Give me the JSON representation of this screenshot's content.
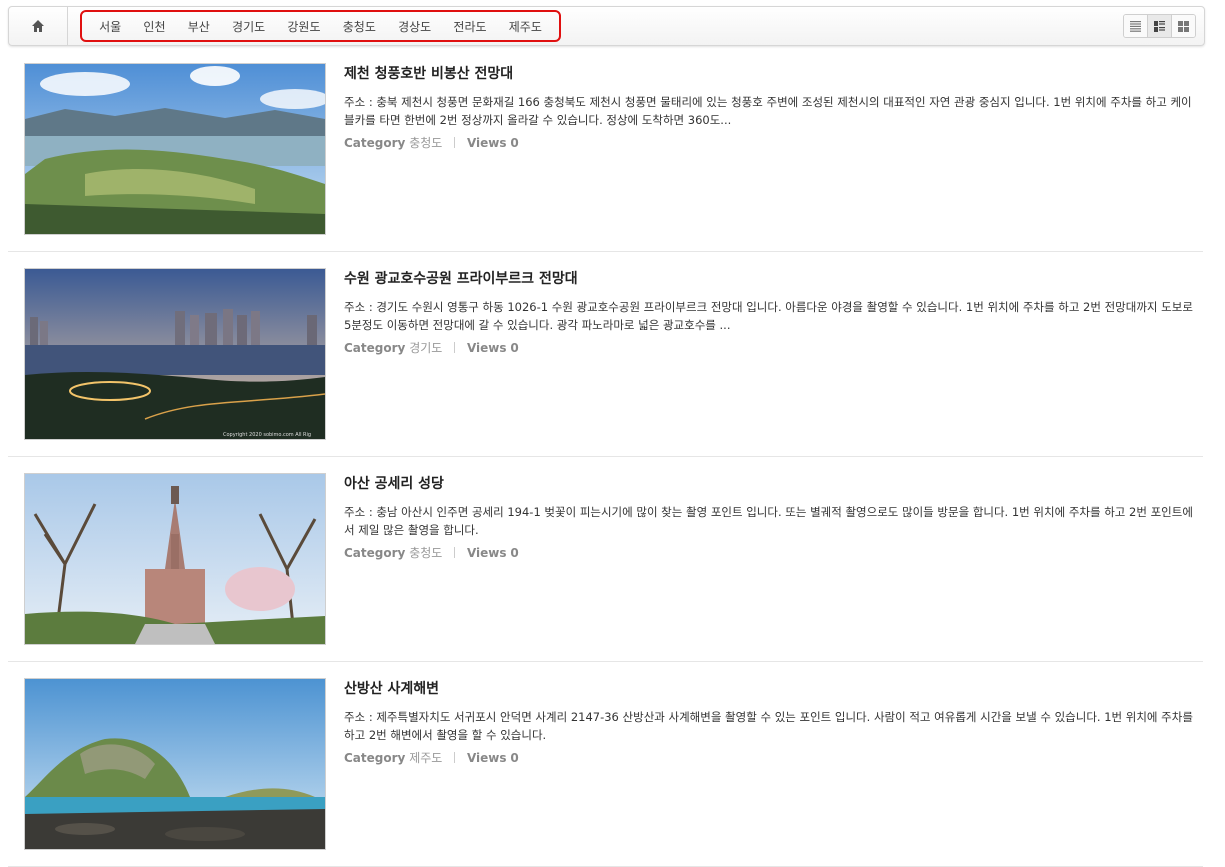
{
  "nav": {
    "home_icon": "home-icon",
    "categories": [
      "서울",
      "인천",
      "부산",
      "경기도",
      "강원도",
      "충청도",
      "경상도",
      "전라도",
      "제주도"
    ],
    "highlight_color": "#e01010",
    "view_modes": [
      "list-view-icon",
      "webzine-view-icon",
      "gallery-view-icon"
    ]
  },
  "meta_labels": {
    "category": "Category",
    "views": "Views"
  },
  "posts": [
    {
      "title": "제천 청풍호반 비봉산 전망대",
      "desc": "주소 : 충북 제천시 청풍면 문화재길 166 충청북도 제천시 청풍면 물태리에 있는 청풍호 주변에 조성된 제천시의 대표적인 자연 관광 중심지 입니다. 1번 위치에 주차를 하고 케이블카를 타면 한번에 2번 정상까지 올라갈 수 있습니다. 정상에 도착하면 360도...",
      "category": "충청도",
      "views": "0"
    },
    {
      "title": "수원 광교호수공원 프라이부르크 전망대",
      "desc": "주소 : 경기도 수원시 영통구 하동 1026-1 수원 광교호수공원 프라이부르크 전망대 입니다. 아름다운 야경을 촬영할 수 있습니다. 1번 위치에 주차를 하고 2번 전망대까지 도보로 5분정도 이동하면 전망대에 갈 수 있습니다. 광각 파노라마로 넓은 광교호수를 ...",
      "category": "경기도",
      "views": "0",
      "watermark": "Copyright 2020 sobimo.com All Rig"
    },
    {
      "title": "아산 공세리 성당",
      "desc": "주소 : 충남 아산시 인주면 공세리 194-1 벚꽃이 피는시기에 많이 찾는 촬영 포인트 입니다. 또는 별궤적 촬영으로도 많이들 방문을 합니다. 1번 위치에 주차를 하고 2번 포인트에서 제일 많은 촬영을 합니다.",
      "category": "충청도",
      "views": "0"
    },
    {
      "title": "산방산 사계해변",
      "desc": "주소 : 제주특별자치도 서귀포시 안덕면 사계리 2147-36 산방산과 사계해변을 촬영할 수 있는 포인트 입니다. 사람이 적고 여유롭게 시간을 보낼 수 있습니다. 1번 위치에 주차를 하고 2번 해변에서 촬영을 할 수 있습니다.",
      "category": "제주도",
      "views": "0"
    }
  ]
}
